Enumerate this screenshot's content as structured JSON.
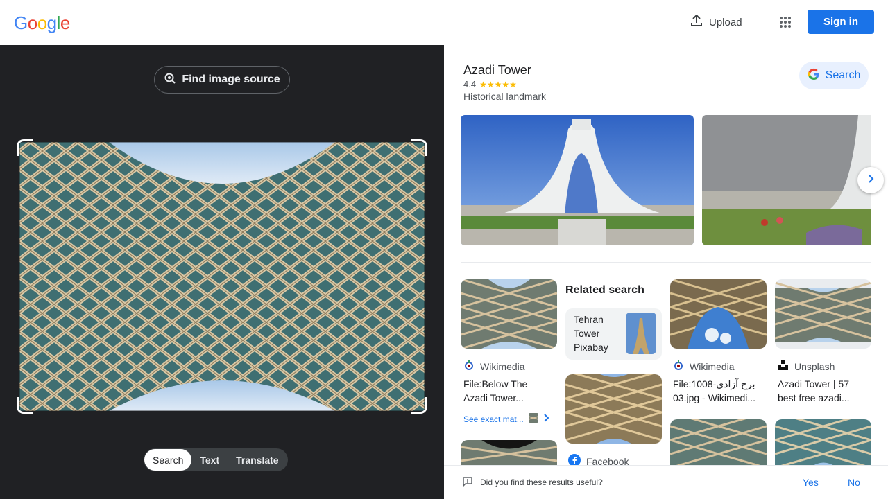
{
  "header": {
    "logo_letters": [
      "G",
      "o",
      "o",
      "g",
      "l",
      "e"
    ],
    "logo_colors": [
      "#4285F4",
      "#EA4335",
      "#FBBC05",
      "#4285F4",
      "#34A853",
      "#EA4335"
    ],
    "upload_label": "Upload",
    "apps_icon": "apps-grid-icon",
    "signin_label": "Sign in"
  },
  "left_pane": {
    "find_source_label": "Find image source",
    "mode_tabs": [
      {
        "label": "Search",
        "active": true
      },
      {
        "label": "Text",
        "active": false
      },
      {
        "label": "Translate",
        "active": false
      }
    ]
  },
  "knowledge_panel": {
    "title": "Azadi Tower",
    "rating": "4.4",
    "stars": "★★★★★",
    "category": "Historical landmark",
    "search_label": "Search"
  },
  "results": {
    "related_heading": "Related search",
    "related_item_lines": [
      "Tehran",
      "Tower",
      "Pixabay"
    ],
    "cards": [
      {
        "source": "Wikimedia",
        "title_line1": "File:Below The",
        "title_line2": "Azadi Tower..."
      },
      {
        "source": "Wikimedia",
        "title_line1": "File:1008-برج آزادی",
        "title_line2": "03.jpg - Wikimedi..."
      },
      {
        "source": "Unsplash",
        "title_line1": "Azadi Tower | 57",
        "title_line2": "best free azadi..."
      },
      {
        "source": "Facebook"
      }
    ],
    "see_exact_label": "See exact mat..."
  },
  "feedback": {
    "question": "Did you find these results useful?",
    "yes_label": "Yes",
    "no_label": "No"
  },
  "colors": {
    "accent_blue": "#1a73e8",
    "dark_pane": "#202124",
    "star_yellow": "#fbbc04"
  }
}
